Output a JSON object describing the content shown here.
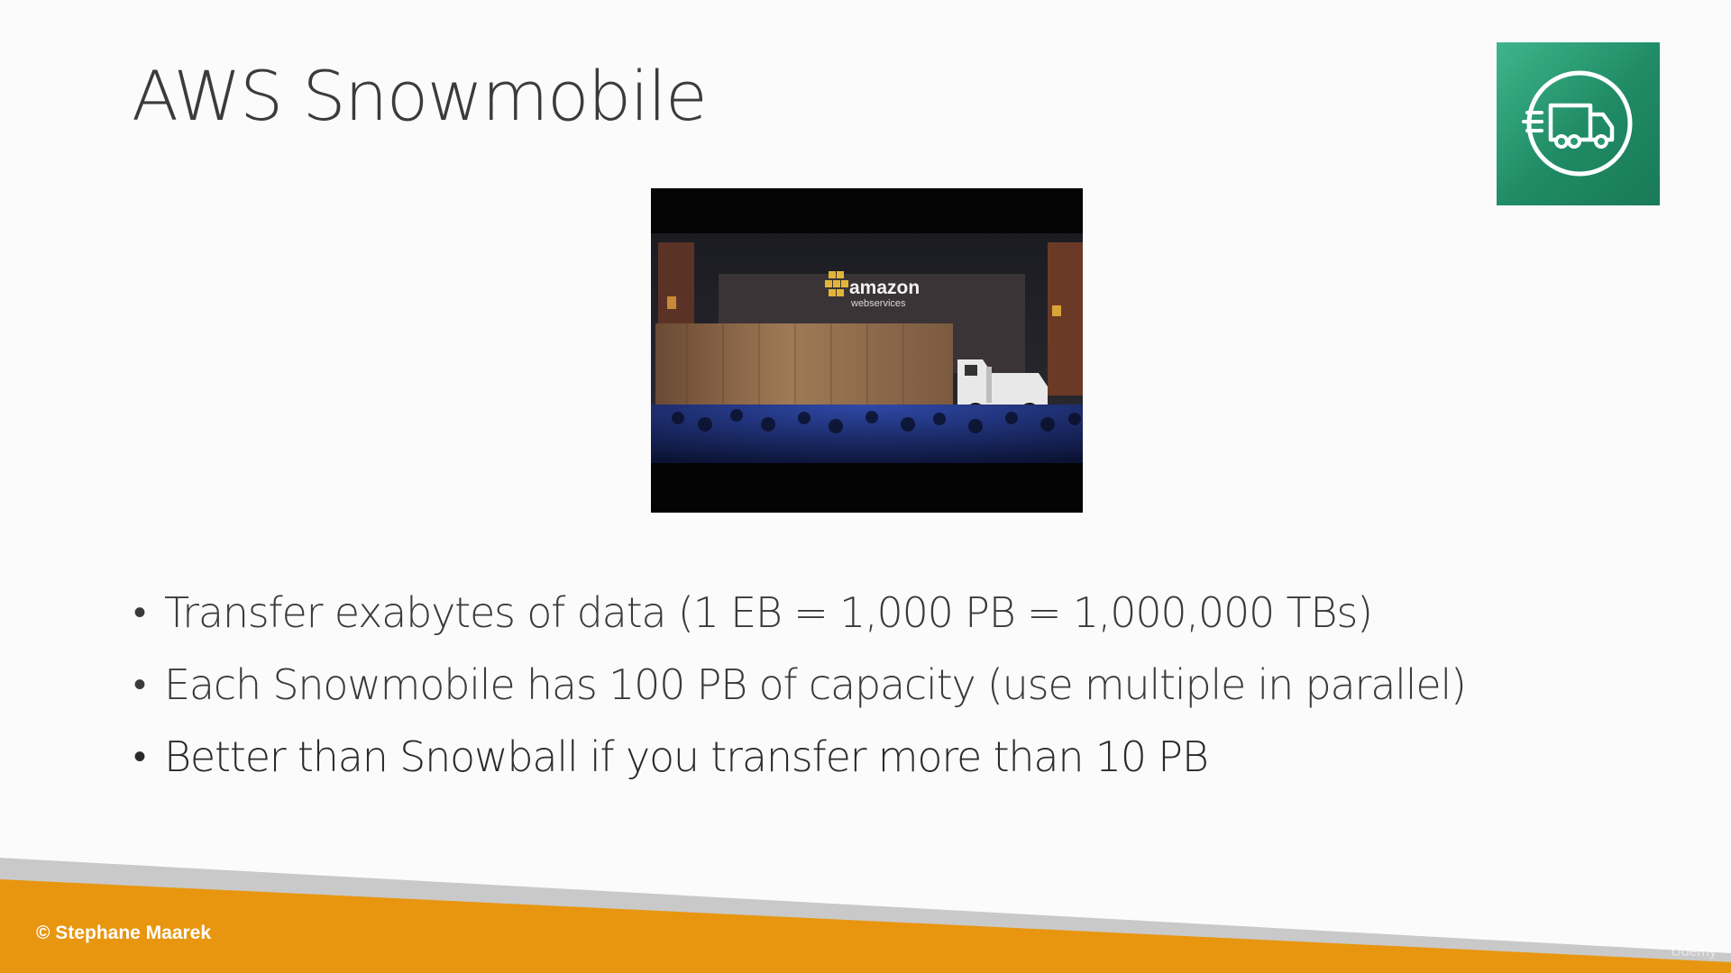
{
  "slide": {
    "title": "AWS Snowmobile",
    "service_icon": "snowmobile-truck-icon",
    "photo": {
      "brand_text": "amazon",
      "brand_subtext": "webservices"
    },
    "bullets": [
      {
        "marker": "•",
        "text": "Transfer exabytes of data (1 EB = 1,000 PB = 1,000,000 TBs)"
      },
      {
        "marker": "•",
        "text": "Each Snowmobile has 100 PB of capacity (use multiple in parallel)"
      },
      {
        "marker": "•",
        "text": "Better than Snowball if you transfer more than 10 PB"
      }
    ],
    "footer": {
      "copyright": "© Stephane Maarek",
      "watermark": "Udemy"
    }
  },
  "colors": {
    "icon_green": "#2a9a72",
    "footer_orange": "#e8960f",
    "footer_gray": "#c9c9c9",
    "text": "#3a3a3a"
  }
}
